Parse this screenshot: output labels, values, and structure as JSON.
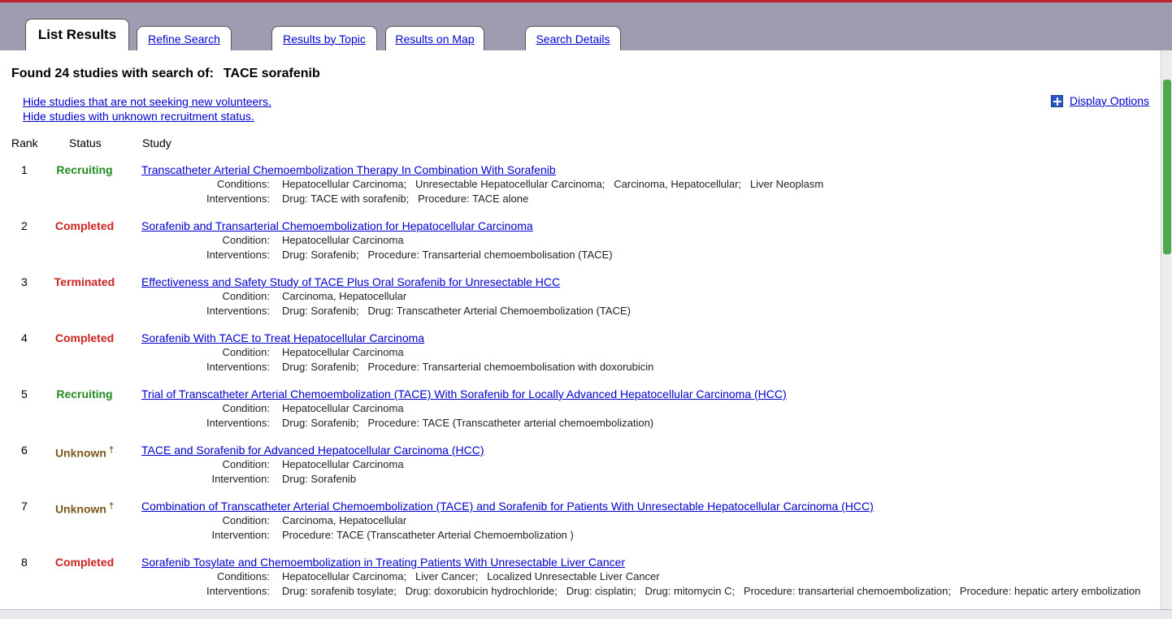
{
  "tabs": [
    {
      "label": "List Results"
    },
    {
      "label": "Refine Search"
    },
    {
      "label": "Results by Topic"
    },
    {
      "label": "Results on Map"
    },
    {
      "label": "Search Details"
    }
  ],
  "found": {
    "text": "Found 24 studies with search of:",
    "term": "TACE sorafenib"
  },
  "hide_links": [
    "Hide studies that are not seeking new volunteers.",
    "Hide studies with unknown recruitment status."
  ],
  "display_options": "Display Options",
  "columns": {
    "rank": "Rank",
    "status": "Status",
    "study": "Study"
  },
  "studies": [
    {
      "rank": "1",
      "status": "Recruiting",
      "title": "Transcatheter Arterial Chemoembolization Therapy In Combination With Sorafenib",
      "cond_label": "Conditions:",
      "cond": "Hepatocellular Carcinoma;   Unresectable Hepatocellular Carcinoma;   Carcinoma, Hepatocellular;   Liver Neoplasm",
      "int_label": "Interventions:",
      "int": "Drug: TACE with sorafenib;   Procedure: TACE alone"
    },
    {
      "rank": "2",
      "status": "Completed",
      "title": "Sorafenib and Transarterial Chemoembolization for Hepatocellular Carcinoma",
      "cond_label": "Condition:",
      "cond": "Hepatocellular Carcinoma",
      "int_label": "Interventions:",
      "int": "Drug: Sorafenib;   Procedure: Transarterial chemoembolisation (TACE)"
    },
    {
      "rank": "3",
      "status": "Terminated",
      "title": "Effectiveness and Safety Study of TACE Plus Oral Sorafenib for Unresectable HCC",
      "cond_label": "Condition:",
      "cond": "Carcinoma, Hepatocellular",
      "int_label": "Interventions:",
      "int": "Drug: Sorafenib;   Drug: Transcatheter Arterial Chemoembolization (TACE)"
    },
    {
      "rank": "4",
      "status": "Completed",
      "title": "Sorafenib With TACE to Treat Hepatocellular Carcinoma",
      "cond_label": "Condition:",
      "cond": "Hepatocellular Carcinoma",
      "int_label": "Interventions:",
      "int": "Drug: Sorafenib;   Procedure: Transarterial chemoembolisation with doxorubicin"
    },
    {
      "rank": "5",
      "status": "Recruiting",
      "title": "Trial of Transcatheter Arterial Chemoembolization (TACE) With Sorafenib for Locally Advanced Hepatocellular Carcinoma (HCC)",
      "cond_label": "Condition:",
      "cond": "Hepatocellular Carcinoma",
      "int_label": "Interventions:",
      "int": "Drug: Sorafenib;   Procedure: TACE (Transcatheter arterial chemoembolization)"
    },
    {
      "rank": "6",
      "status": "Unknown",
      "dagger": "†",
      "title": "TACE and Sorafenib for Advanced Hepatocellular Carcinoma (HCC)",
      "cond_label": "Condition:",
      "cond": "Hepatocellular Carcinoma",
      "int_label": "Intervention:",
      "int": "Drug: Sorafenib"
    },
    {
      "rank": "7",
      "status": "Unknown",
      "dagger": "†",
      "title": "Combination of Transcatheter Arterial Chemoembolization (TACE) and Sorafenib for Patients With Unresectable Hepatocellular Carcinoma (HCC)",
      "cond_label": "Condition:",
      "cond": "Carcinoma, Hepatocellular",
      "int_label": "Intervention:",
      "int": "Procedure: TACE (Transcatheter Arterial Chemoembolization )"
    },
    {
      "rank": "8",
      "status": "Completed",
      "title": "Sorafenib Tosylate and Chemoembolization in Treating Patients With Unresectable Liver Cancer",
      "cond_label": "Conditions:",
      "cond": "Hepatocellular Carcinoma;   Liver Cancer;   Localized Unresectable Liver Cancer",
      "int_label": "Interventions:",
      "int": "Drug: sorafenib tosylate;   Drug: doxorubicin hydrochloride;   Drug: cisplatin;   Drug: mitomycin C;   Procedure: transarterial chemoembolization;   Procedure: hepatic artery embolization"
    }
  ],
  "colors": {
    "recruiting": "#228b22",
    "completed": "#cc2222",
    "unknown": "#7a5a1c",
    "link": "#0000cc",
    "tabbar": "#9d9cb0"
  }
}
